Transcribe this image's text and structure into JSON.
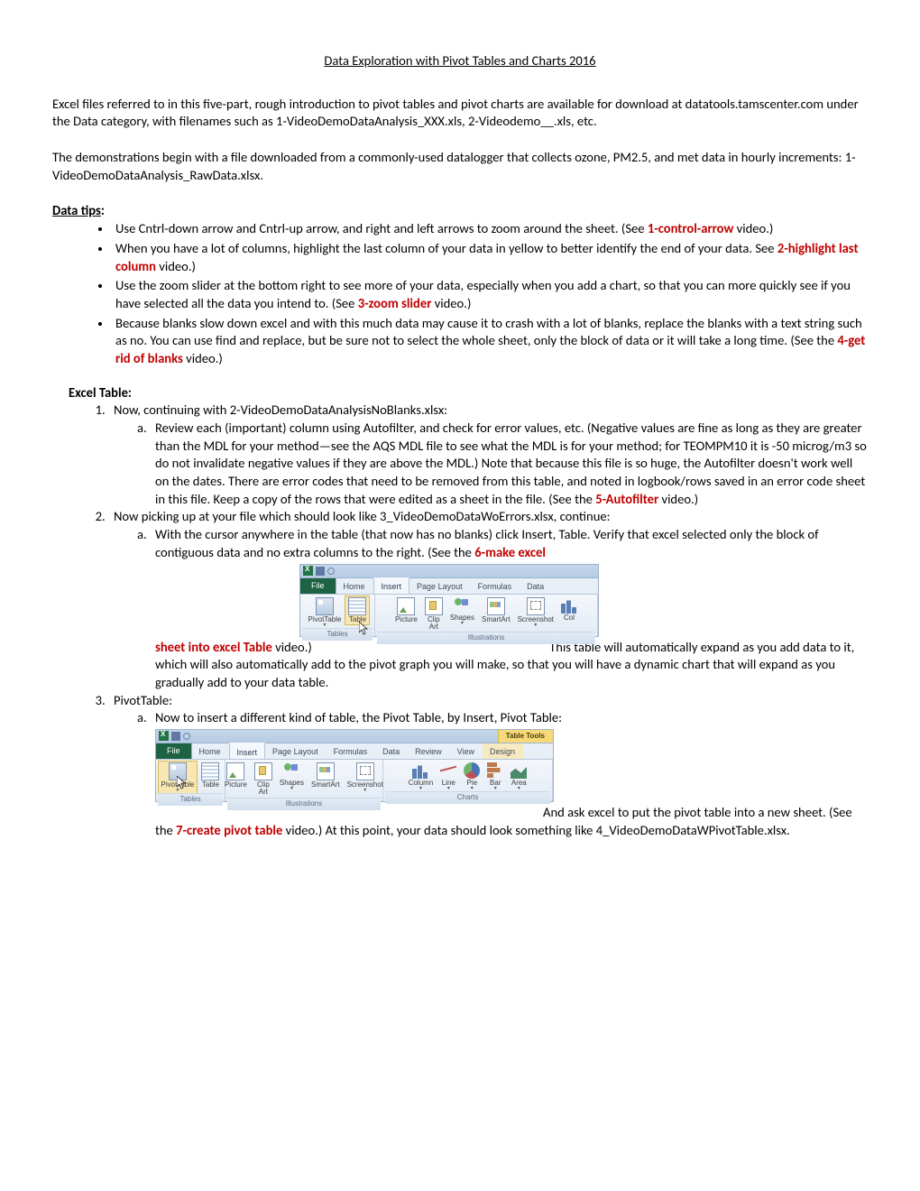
{
  "title": "Data Exploration with Pivot Tables and Charts 2016",
  "intro1": "Excel files referred to in this five-part, rough introduction to pivot tables and pivot charts are available for download at datatools.tamscenter.com under the Data category, with filenames such as 1-VideoDemoDataAnalysis_XXX.xls, 2-Videodemo__.xls, etc.",
  "intro2": "The demonstrations begin with a file downloaded from a commonly-used datalogger that collects ozone, PM2.5, and met data in hourly increments: 1-VideoDemoDataAnalysis_RawData.xlsx.",
  "data_tips_head": "Data tips",
  "tips": {
    "t1a": "Use Cntrl-down arrow and Cntrl-up arrow, and right and left arrows to zoom around the sheet.  (See ",
    "t1red": "1-control-arrow",
    "t1b": " video.)",
    "t2a": "When you have a lot of columns, highlight the last column of your data in yellow to better identify the end of your data. See ",
    "t2red": "2-highlight last column",
    "t2b": " video.)",
    "t3a": "Use the zoom slider at the bottom right to see more of your data, especially when you add a chart, so that you can more quickly see if you have selected all the data you intend to.  (See ",
    "t3red": "3-zoom slider",
    "t3b": " video.)",
    "t4a": "Because blanks slow down excel and with this much data may cause it to crash with a lot of blanks, replace the blanks with a text string such as no.  You can use find and replace, but be sure not to select the whole sheet, only the block of data or it will take a long time. (See the ",
    "t4red": "4-get rid of blanks",
    "t4b": " video.)"
  },
  "excel_table_head": "Excel Table:",
  "ol1": {
    "n1": "Now, continuing with 2-VideoDemoDataAnalysisNoBlanks.xlsx:",
    "n1a_a": "Review each (important) column using Autofilter, and check for error values, etc.  (Negative values are fine as long as they are greater than the MDL for your method—see the AQS MDL file to see what the MDL is for your method; for TEOMPM10 it is -50 microg/m3 so do not invalidate negative values if they are above the MDL.)  Note that because this file is so huge, the Autofilter doesn't work well on the dates.  There are error codes that need to be removed from this table, and noted in logbook/rows saved in an error code sheet in this file.  Keep a copy of the rows that were edited as a sheet in the file.  (See the ",
    "n1a_red": "5-Autofilter",
    "n1a_b": " video.)",
    "n2": "Now picking up at your file which should look like 3_VideoDemoDataWoErrors.xlsx, continue:",
    "n2a_a": "With the cursor anywhere in the table (that now has no blanks) click Insert, Table. Verify that excel selected only the block of contiguous data and no extra columns to the right.  (See the ",
    "n2a_red1": "6-make excel",
    "n2a_red2": "sheet into excel Table",
    "n2a_mid": " video.)",
    "n2a_tail": "This table will automatically expand as you add data to it, which will also automatically add to the pivot graph you will make, so that you will have a dynamic chart that will expand as you gradually add to your data table.",
    "n3": "PivotTable:",
    "n3a_a": "Now to insert a different kind of table, the Pivot Table, by Insert, Pivot Table:",
    "n3a_tail_a": "And ask excel to put the pivot table into a new sheet. (See the ",
    "n3a_red": "7-create pivot table",
    "n3a_tail_b": " video.)  At this point, your data should look something like 4_VideoDemoDataWPivotTable.xlsx."
  },
  "ribbon1": {
    "tabs": {
      "file": "File",
      "home": "Home",
      "insert": "Insert",
      "pagelayout": "Page Layout",
      "formulas": "Formulas",
      "data": "Data"
    },
    "tools": {
      "pivot": "PivotTable",
      "table": "Table",
      "picture": "Picture",
      "clip": "Clip\nArt",
      "shapes": "Shapes",
      "smart": "SmartArt",
      "screen": "Screenshot",
      "col": "Col"
    },
    "groups": {
      "tables": "Tables",
      "illus": "Illustrations"
    }
  },
  "ribbon2": {
    "context": "Table Tools",
    "tabs": {
      "file": "File",
      "home": "Home",
      "insert": "Insert",
      "pagelayout": "Page Layout",
      "formulas": "Formulas",
      "data": "Data",
      "review": "Review",
      "view": "View",
      "design": "Design"
    },
    "tools": {
      "pivot": "PivotTable",
      "table": "Table",
      "picture": "Picture",
      "clip": "Clip\nArt",
      "shapes": "Shapes",
      "smart": "SmartArt",
      "screen": "Screenshot",
      "column": "Column",
      "line": "Line",
      "pie": "Pie",
      "bar": "Bar",
      "area": "Area"
    },
    "groups": {
      "tables": "Tables",
      "illus": "Illustrations",
      "charts": "Charts"
    }
  }
}
